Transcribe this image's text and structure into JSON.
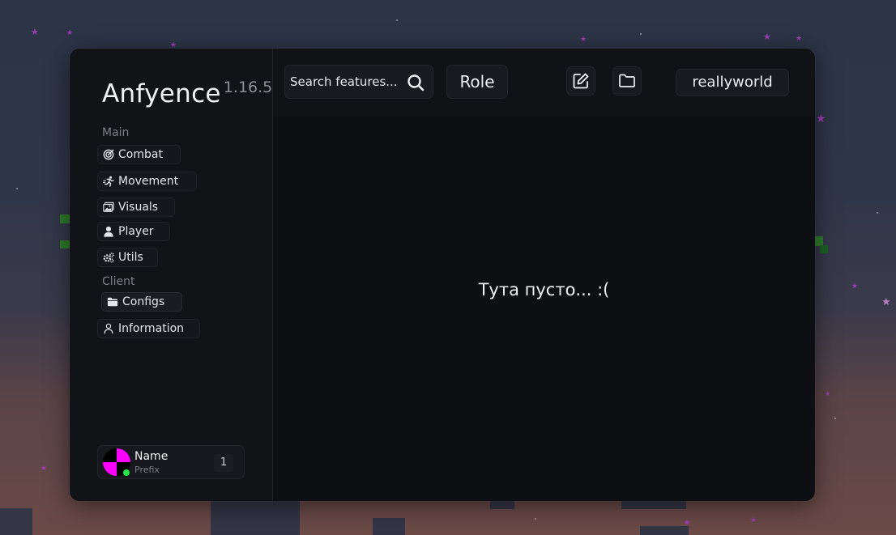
{
  "app": {
    "name": "Anfyence",
    "version": "1.16.5"
  },
  "sidebar": {
    "sections": [
      {
        "label": "Main",
        "items": [
          {
            "label": "Combat",
            "icon": "target-icon"
          },
          {
            "label": "Movement",
            "icon": "running-icon"
          },
          {
            "label": "Visuals",
            "icon": "image-icon"
          },
          {
            "label": "Player",
            "icon": "user-icon"
          },
          {
            "label": "Utils",
            "icon": "gears-icon"
          }
        ]
      },
      {
        "label": "Client",
        "items": [
          {
            "label": "Configs",
            "icon": "folder-icon"
          },
          {
            "label": "Information",
            "icon": "user-outline-icon"
          }
        ]
      }
    ]
  },
  "user": {
    "name": "Name",
    "prefix": "Prefix",
    "count": "1",
    "status": "online"
  },
  "topbar": {
    "search_placeholder": "Search features...",
    "role_label": "Role",
    "server_label": "reallyworld"
  },
  "main": {
    "empty_message": "Тута пусто... :("
  },
  "colors": {
    "panel": "#0e0f12",
    "sidebar": "#121317",
    "text": "#f1f1f4",
    "muted": "#7c7e87",
    "online": "#27e24a",
    "avatar_accent": "#ff00ff"
  }
}
